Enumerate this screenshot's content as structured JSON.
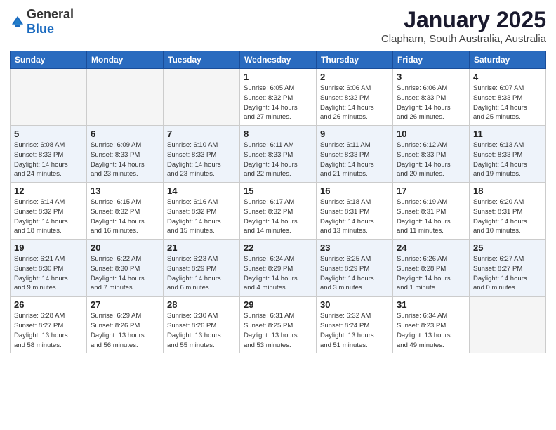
{
  "header": {
    "logo_general": "General",
    "logo_blue": "Blue",
    "month": "January 2025",
    "location": "Clapham, South Australia, Australia"
  },
  "weekdays": [
    "Sunday",
    "Monday",
    "Tuesday",
    "Wednesday",
    "Thursday",
    "Friday",
    "Saturday"
  ],
  "weeks": [
    [
      {
        "day": "",
        "info": ""
      },
      {
        "day": "",
        "info": ""
      },
      {
        "day": "",
        "info": ""
      },
      {
        "day": "1",
        "info": "Sunrise: 6:05 AM\nSunset: 8:32 PM\nDaylight: 14 hours\nand 27 minutes."
      },
      {
        "day": "2",
        "info": "Sunrise: 6:06 AM\nSunset: 8:32 PM\nDaylight: 14 hours\nand 26 minutes."
      },
      {
        "day": "3",
        "info": "Sunrise: 6:06 AM\nSunset: 8:33 PM\nDaylight: 14 hours\nand 26 minutes."
      },
      {
        "day": "4",
        "info": "Sunrise: 6:07 AM\nSunset: 8:33 PM\nDaylight: 14 hours\nand 25 minutes."
      }
    ],
    [
      {
        "day": "5",
        "info": "Sunrise: 6:08 AM\nSunset: 8:33 PM\nDaylight: 14 hours\nand 24 minutes."
      },
      {
        "day": "6",
        "info": "Sunrise: 6:09 AM\nSunset: 8:33 PM\nDaylight: 14 hours\nand 23 minutes."
      },
      {
        "day": "7",
        "info": "Sunrise: 6:10 AM\nSunset: 8:33 PM\nDaylight: 14 hours\nand 23 minutes."
      },
      {
        "day": "8",
        "info": "Sunrise: 6:11 AM\nSunset: 8:33 PM\nDaylight: 14 hours\nand 22 minutes."
      },
      {
        "day": "9",
        "info": "Sunrise: 6:11 AM\nSunset: 8:33 PM\nDaylight: 14 hours\nand 21 minutes."
      },
      {
        "day": "10",
        "info": "Sunrise: 6:12 AM\nSunset: 8:33 PM\nDaylight: 14 hours\nand 20 minutes."
      },
      {
        "day": "11",
        "info": "Sunrise: 6:13 AM\nSunset: 8:33 PM\nDaylight: 14 hours\nand 19 minutes."
      }
    ],
    [
      {
        "day": "12",
        "info": "Sunrise: 6:14 AM\nSunset: 8:32 PM\nDaylight: 14 hours\nand 18 minutes."
      },
      {
        "day": "13",
        "info": "Sunrise: 6:15 AM\nSunset: 8:32 PM\nDaylight: 14 hours\nand 16 minutes."
      },
      {
        "day": "14",
        "info": "Sunrise: 6:16 AM\nSunset: 8:32 PM\nDaylight: 14 hours\nand 15 minutes."
      },
      {
        "day": "15",
        "info": "Sunrise: 6:17 AM\nSunset: 8:32 PM\nDaylight: 14 hours\nand 14 minutes."
      },
      {
        "day": "16",
        "info": "Sunrise: 6:18 AM\nSunset: 8:31 PM\nDaylight: 14 hours\nand 13 minutes."
      },
      {
        "day": "17",
        "info": "Sunrise: 6:19 AM\nSunset: 8:31 PM\nDaylight: 14 hours\nand 11 minutes."
      },
      {
        "day": "18",
        "info": "Sunrise: 6:20 AM\nSunset: 8:31 PM\nDaylight: 14 hours\nand 10 minutes."
      }
    ],
    [
      {
        "day": "19",
        "info": "Sunrise: 6:21 AM\nSunset: 8:30 PM\nDaylight: 14 hours\nand 9 minutes."
      },
      {
        "day": "20",
        "info": "Sunrise: 6:22 AM\nSunset: 8:30 PM\nDaylight: 14 hours\nand 7 minutes."
      },
      {
        "day": "21",
        "info": "Sunrise: 6:23 AM\nSunset: 8:29 PM\nDaylight: 14 hours\nand 6 minutes."
      },
      {
        "day": "22",
        "info": "Sunrise: 6:24 AM\nSunset: 8:29 PM\nDaylight: 14 hours\nand 4 minutes."
      },
      {
        "day": "23",
        "info": "Sunrise: 6:25 AM\nSunset: 8:29 PM\nDaylight: 14 hours\nand 3 minutes."
      },
      {
        "day": "24",
        "info": "Sunrise: 6:26 AM\nSunset: 8:28 PM\nDaylight: 14 hours\nand 1 minute."
      },
      {
        "day": "25",
        "info": "Sunrise: 6:27 AM\nSunset: 8:27 PM\nDaylight: 14 hours\nand 0 minutes."
      }
    ],
    [
      {
        "day": "26",
        "info": "Sunrise: 6:28 AM\nSunset: 8:27 PM\nDaylight: 13 hours\nand 58 minutes."
      },
      {
        "day": "27",
        "info": "Sunrise: 6:29 AM\nSunset: 8:26 PM\nDaylight: 13 hours\nand 56 minutes."
      },
      {
        "day": "28",
        "info": "Sunrise: 6:30 AM\nSunset: 8:26 PM\nDaylight: 13 hours\nand 55 minutes."
      },
      {
        "day": "29",
        "info": "Sunrise: 6:31 AM\nSunset: 8:25 PM\nDaylight: 13 hours\nand 53 minutes."
      },
      {
        "day": "30",
        "info": "Sunrise: 6:32 AM\nSunset: 8:24 PM\nDaylight: 13 hours\nand 51 minutes."
      },
      {
        "day": "31",
        "info": "Sunrise: 6:34 AM\nSunset: 8:23 PM\nDaylight: 13 hours\nand 49 minutes."
      },
      {
        "day": "",
        "info": ""
      }
    ]
  ]
}
